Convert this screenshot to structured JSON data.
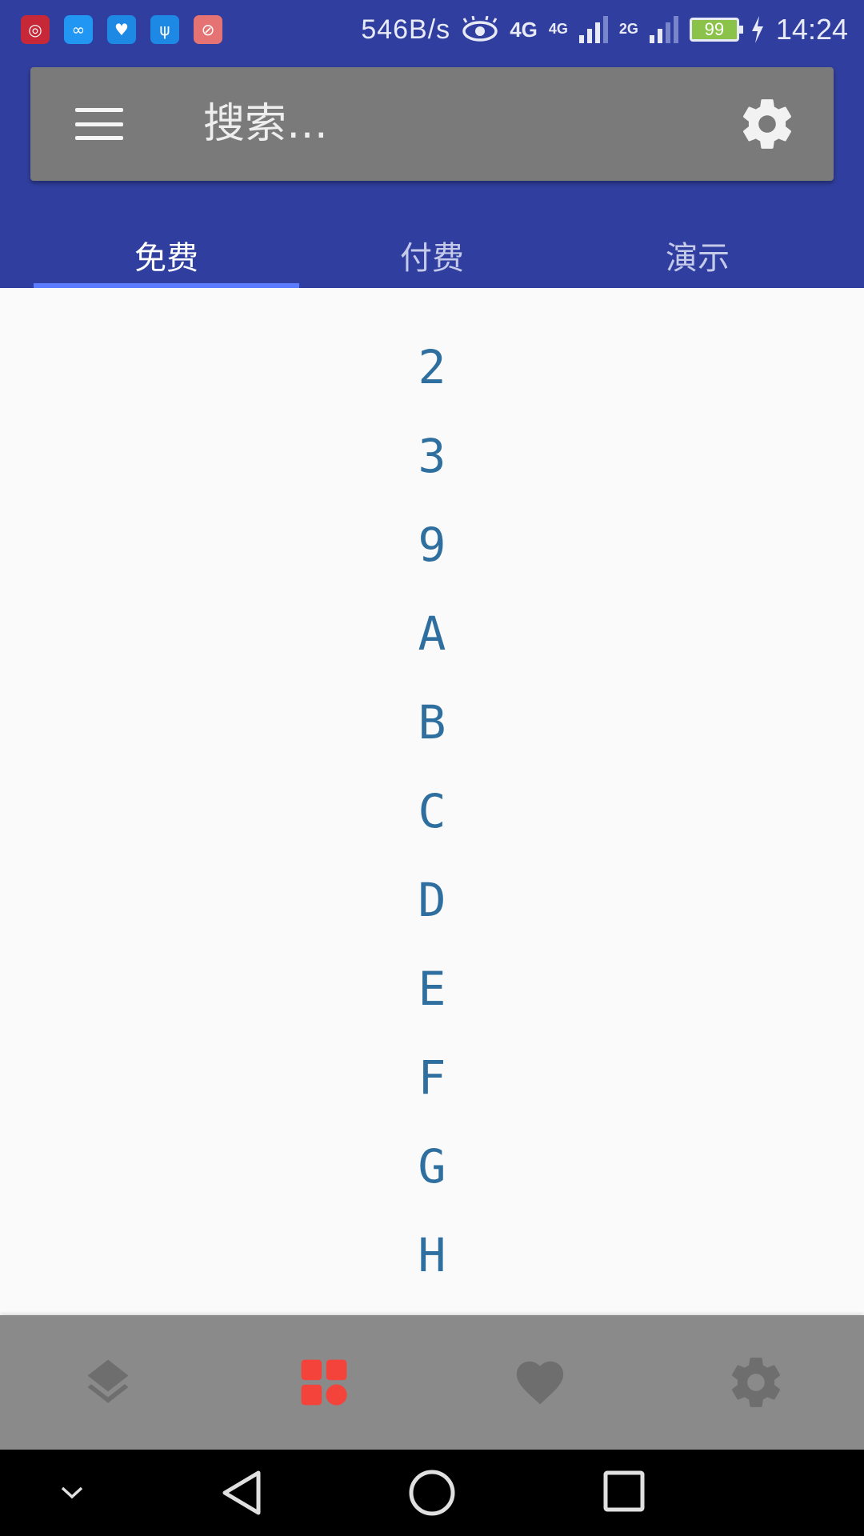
{
  "status_bar": {
    "notification_icons": [
      {
        "name": "netease-music-icon",
        "color": "#c62838",
        "glyph": "◎"
      },
      {
        "name": "link-app-icon",
        "color": "#2196f3",
        "glyph": "∞"
      },
      {
        "name": "health-icon",
        "color": "#1e88e5",
        "glyph": "♥"
      },
      {
        "name": "usb-icon",
        "color": "#1e88e5",
        "glyph": "ψ"
      },
      {
        "name": "blocked-icon",
        "color": "#e57373",
        "glyph": "⊘"
      }
    ],
    "net_speed": "546B/s",
    "network_primary": "4G",
    "network_primary_small": "4G",
    "network_secondary": "2G",
    "battery_level": "99",
    "time": "14:24"
  },
  "search": {
    "placeholder": "搜索…"
  },
  "tabs": [
    {
      "label": "免费",
      "active": true
    },
    {
      "label": "付费",
      "active": false
    },
    {
      "label": "演示",
      "active": false
    }
  ],
  "letters": [
    "2",
    "3",
    "9",
    "A",
    "B",
    "C",
    "D",
    "E",
    "F",
    "G",
    "H"
  ],
  "bottom_nav": [
    {
      "name": "layers-icon",
      "active": false
    },
    {
      "name": "grid-icon",
      "active": true
    },
    {
      "name": "heart-icon",
      "active": false
    },
    {
      "name": "settings-icon",
      "active": false
    }
  ],
  "colors": {
    "primary": "#303f9f",
    "accent_indicator": "#5c7cff",
    "letter_text": "#2f6f9f",
    "nav_active": "#f4433a",
    "nav_inactive": "#6e6e6e"
  }
}
